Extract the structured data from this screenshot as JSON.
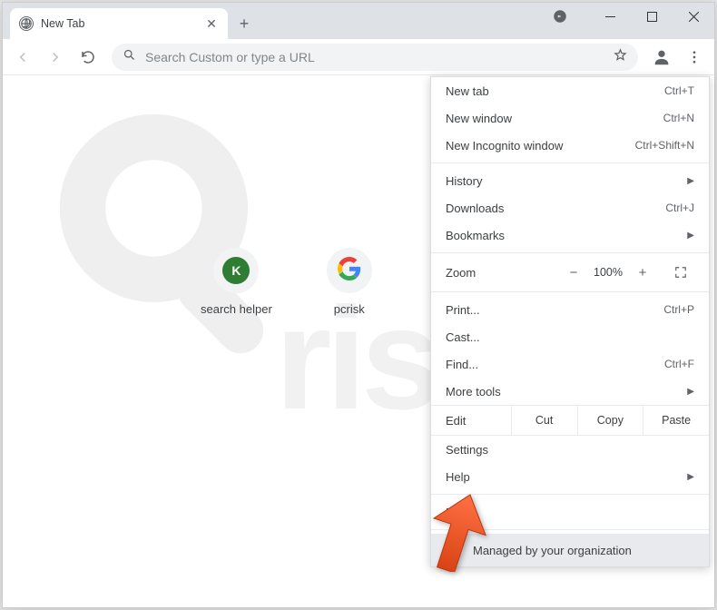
{
  "tab": {
    "title": "New Tab"
  },
  "omnibox": {
    "placeholder": "Search Custom or type a URL"
  },
  "shortcuts": [
    {
      "label": "search helper",
      "badge": "K"
    },
    {
      "label": "pcrisk",
      "badge": "G"
    }
  ],
  "menu": {
    "new_tab": {
      "label": "New tab",
      "shortcut": "Ctrl+T"
    },
    "new_window": {
      "label": "New window",
      "shortcut": "Ctrl+N"
    },
    "new_incognito": {
      "label": "New Incognito window",
      "shortcut": "Ctrl+Shift+N"
    },
    "history": {
      "label": "History"
    },
    "downloads": {
      "label": "Downloads",
      "shortcut": "Ctrl+J"
    },
    "bookmarks": {
      "label": "Bookmarks"
    },
    "zoom": {
      "label": "Zoom",
      "value": "100%"
    },
    "print": {
      "label": "Print...",
      "shortcut": "Ctrl+P"
    },
    "cast": {
      "label": "Cast..."
    },
    "find": {
      "label": "Find...",
      "shortcut": "Ctrl+F"
    },
    "more_tools": {
      "label": "More tools"
    },
    "edit": {
      "label": "Edit",
      "cut": "Cut",
      "copy": "Copy",
      "paste": "Paste"
    },
    "settings": {
      "label": "Settings"
    },
    "help": {
      "label": "Help"
    },
    "exit": {
      "label": "Exit"
    },
    "managed": {
      "label": "Managed by your organization"
    }
  },
  "watermark": {
    "text": "risk.com"
  }
}
